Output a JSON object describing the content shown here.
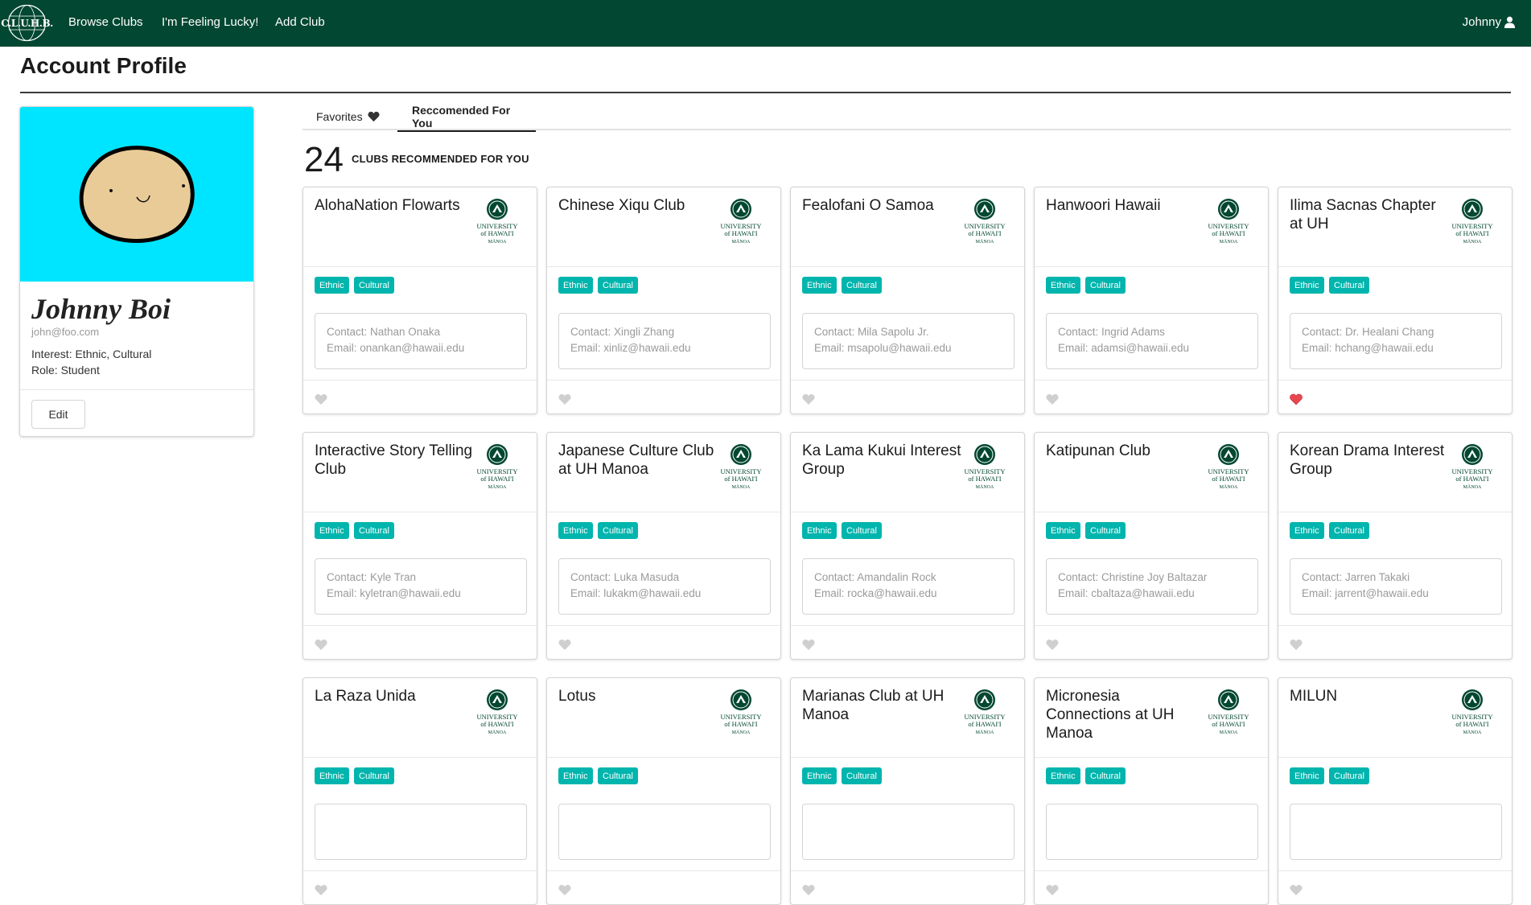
{
  "nav": {
    "logo_text": "C.L.U.H.B.",
    "links": [
      "Browse Clubs",
      "I'm Feeling Lucky!",
      "Add Club"
    ],
    "user": "Johnny"
  },
  "page": {
    "title": "Account Profile"
  },
  "profile": {
    "name": "Johnny Boi",
    "email": "john@foo.com",
    "interest": "Interest: Ethnic, Cultural",
    "role": "Role: Student",
    "edit_label": "Edit",
    "avatar_bg": "#00e5ff"
  },
  "tabs": {
    "favorites": "Favorites",
    "recommended": "Reccomended For You"
  },
  "count": {
    "number": "24",
    "label": "CLUBS RECOMMENDED FOR YOU"
  },
  "clubs": [
    {
      "name": "AlohaNation Flowarts",
      "tags": [
        "Ethnic",
        "Cultural"
      ],
      "contact": "Contact: Nathan Onaka",
      "email": "Email: onankan@hawaii.edu",
      "favorited": false
    },
    {
      "name": "Chinese Xiqu Club",
      "tags": [
        "Ethnic",
        "Cultural"
      ],
      "contact": "Contact: Xingli Zhang",
      "email": "Email: xinliz@hawaii.edu",
      "favorited": false
    },
    {
      "name": "Fealofani O Samoa",
      "tags": [
        "Ethnic",
        "Cultural"
      ],
      "contact": "Contact: Mila Sapolu Jr.",
      "email": "Email: msapolu@hawaii.edu",
      "favorited": false
    },
    {
      "name": "Hanwoori Hawaii",
      "tags": [
        "Ethnic",
        "Cultural"
      ],
      "contact": "Contact: Ingrid Adams",
      "email": "Email: adamsi@hawaii.edu",
      "favorited": false
    },
    {
      "name": "Ilima Sacnas Chapter at UH",
      "tags": [
        "Ethnic",
        "Cultural"
      ],
      "contact": "Contact: Dr. Healani Chang",
      "email": "Email: hchang@hawaii.edu",
      "favorited": true
    },
    {
      "name": "Interactive Story Telling Club",
      "tags": [
        "Ethnic",
        "Cultural"
      ],
      "contact": "Contact: Kyle Tran",
      "email": "Email: kyletran@hawaii.edu",
      "favorited": false
    },
    {
      "name": "Japanese Culture Club at UH Manoa",
      "tags": [
        "Ethnic",
        "Cultural"
      ],
      "contact": "Contact: Luka Masuda",
      "email": "Email: lukakm@hawaii.edu",
      "favorited": false
    },
    {
      "name": "Ka Lama Kukui Interest Group",
      "tags": [
        "Ethnic",
        "Cultural"
      ],
      "contact": "Contact: Amandalin Rock",
      "email": "Email: rocka@hawaii.edu",
      "favorited": false
    },
    {
      "name": "Katipunan Club",
      "tags": [
        "Ethnic",
        "Cultural"
      ],
      "contact": "Contact: Christine Joy Baltazar",
      "email": "Email: cbaltaza@hawaii.edu",
      "favorited": false
    },
    {
      "name": "Korean Drama Interest Group",
      "tags": [
        "Ethnic",
        "Cultural"
      ],
      "contact": "Contact: Jarren Takaki",
      "email": "Email: jarrent@hawaii.edu",
      "favorited": false
    },
    {
      "name": "La Raza Unida",
      "tags": [
        "Ethnic",
        "Cultural"
      ],
      "contact": "",
      "email": "",
      "favorited": false
    },
    {
      "name": "Lotus",
      "tags": [
        "Ethnic",
        "Cultural"
      ],
      "contact": "",
      "email": "",
      "favorited": false
    },
    {
      "name": "Marianas Club at UH Manoa",
      "tags": [
        "Ethnic",
        "Cultural"
      ],
      "contact": "",
      "email": "",
      "favorited": false
    },
    {
      "name": "Micronesia Connections at UH Manoa",
      "tags": [
        "Ethnic",
        "Cultural"
      ],
      "contact": "",
      "email": "",
      "favorited": false
    },
    {
      "name": "MILUN",
      "tags": [
        "Ethnic",
        "Cultural"
      ],
      "contact": "",
      "email": "",
      "favorited": false
    }
  ],
  "uh_logo": {
    "line1": "UNIVERSITY",
    "line2": "of HAWAI'I",
    "line3": "MĀNOA"
  },
  "colors": {
    "nav": "#024731",
    "tag": "#00b5ad",
    "heart_on": "#e8474f",
    "heart_off": "#cfcfcf"
  }
}
